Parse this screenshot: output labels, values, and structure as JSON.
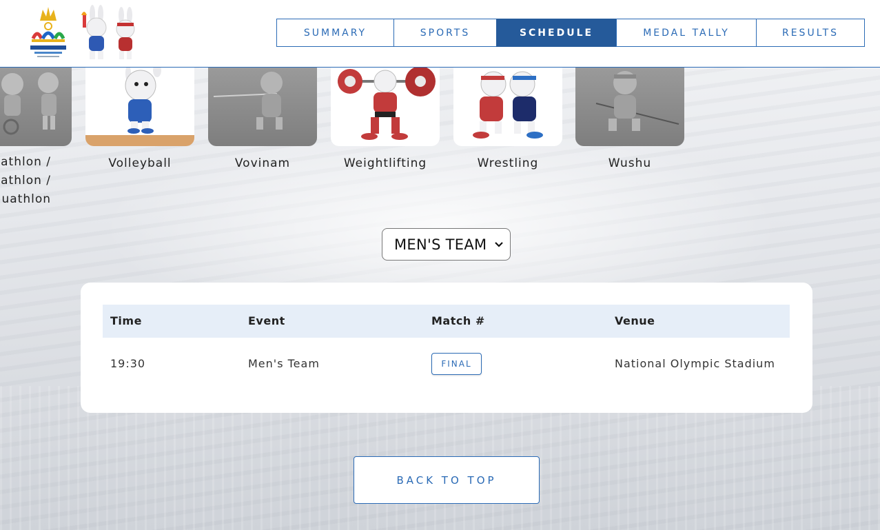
{
  "header": {
    "logo_alt": "CAMBODIA 2023",
    "nav": [
      {
        "label": "SUMMARY",
        "active": false
      },
      {
        "label": "SPORTS",
        "active": false
      },
      {
        "label": "SCHEDULE",
        "active": true
      },
      {
        "label": "MEDAL TALLY",
        "active": false
      },
      {
        "label": "RESULTS",
        "active": false
      }
    ]
  },
  "sports": {
    "partial_label": [
      "athlon /",
      "athlon /",
      "uathlon"
    ],
    "items": [
      {
        "label": "Volleyball",
        "icon": "volleyball-mascot"
      },
      {
        "label": "Vovinam",
        "icon": "vovinam-mascot"
      },
      {
        "label": "Weightlifting",
        "icon": "weightlifting-mascot"
      },
      {
        "label": "Wrestling",
        "icon": "wrestling-mascot"
      },
      {
        "label": "Wushu",
        "icon": "wushu-mascot"
      }
    ]
  },
  "filter": {
    "selected": "MEN'S TEAM"
  },
  "table": {
    "headers": {
      "time": "Time",
      "event": "Event",
      "match": "Match #",
      "venue": "Venue"
    },
    "rows": [
      {
        "time": "19:30",
        "event": "Men's Team",
        "match": "FINAL",
        "venue": "National Olympic Stadium"
      }
    ]
  },
  "back_to_top": "BACK TO TOP",
  "colors": {
    "accent": "#2a6ab5",
    "active_nav": "#255a9a",
    "table_header": "#e6eef8"
  }
}
